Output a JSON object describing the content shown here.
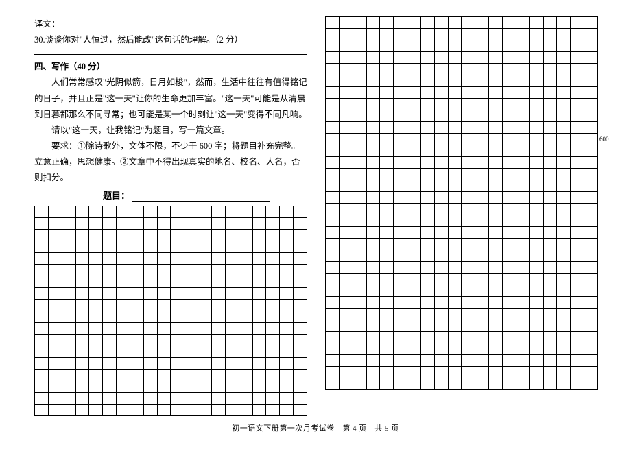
{
  "q29_label": "译文：",
  "q30_text": "30.谈谈你对\"人恒过，然后能改\"这句话的理解。（2 分）",
  "section": {
    "heading": "四、写作（40 分）",
    "p1": "　　人们常常感叹\"光阴似箭，日月如梭\"，然而，生活中往往有值得铭记的日子，并且正是\"这一天\"让你的生命更加丰富。\"这一天\"可能是从清晨到日暮都那么不同寻常；也可能是某一个时刻让\"这一天\"变得不同凡响。",
    "p2": "　　请以\"这一天，让我铭记\"为题目，写一篇文章。",
    "p3": "　　要求：①除诗歌外，文体不限，不少于 600 字；将题目补充完整。立意正确，思想健康。②文章中不得出现真实的地名、校名、人名，否则扣分。",
    "title_label": "题目：",
    "title_value": ""
  },
  "grid": {
    "cols": 20,
    "left_rows": 18,
    "right_rows": 32,
    "marker_label": "600",
    "marker_row": 10
  },
  "footer": "初一语文下册第一次月考试卷　第 4 页　共 5 页"
}
